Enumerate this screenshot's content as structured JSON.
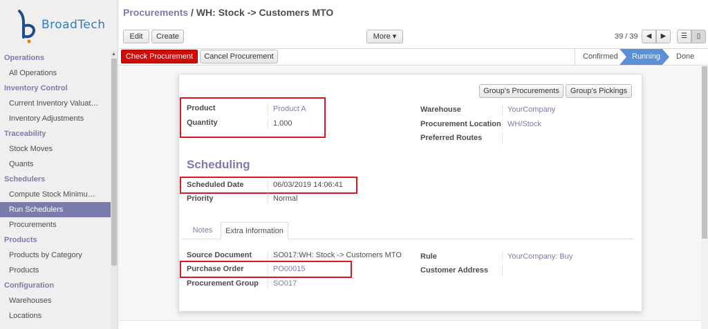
{
  "app": {
    "logo_text": "BroadTech"
  },
  "sidebar": {
    "sections": [
      {
        "title": "Operations",
        "items": [
          "All Operations"
        ]
      },
      {
        "title": "Inventory Control",
        "items": [
          "Current Inventory Valuat…",
          "Inventory Adjustments"
        ]
      },
      {
        "title": "Traceability",
        "items": [
          "Stock Moves",
          "Quants"
        ]
      },
      {
        "title": "Schedulers",
        "items": [
          "Compute Stock Minimu…",
          "Run Schedulers",
          "Procurements"
        ]
      },
      {
        "title": "Products",
        "items": [
          "Products by Category",
          "Products"
        ]
      },
      {
        "title": "Configuration",
        "items": [
          "Warehouses",
          "Locations"
        ]
      }
    ],
    "active_item": "Run Schedulers"
  },
  "breadcrumb": {
    "parent": "Procurements",
    "separator": " / ",
    "current": "WH: Stock -> Customers MTO"
  },
  "toolbar": {
    "edit_label": "Edit",
    "create_label": "Create",
    "more_label": "More ▾",
    "pager": "39 / 39"
  },
  "statusbar": {
    "check_label": "Check Procurement",
    "cancel_label": "Cancel Procurement",
    "stages": [
      "Confirmed",
      "Running",
      "Done"
    ],
    "active_stage": "Running",
    "active_color": "#5d8fd6"
  },
  "form": {
    "group_procurements_label": "Group's Procurements",
    "group_pickings_label": "Group's Pickings",
    "product_label": "Product",
    "product_value": "Product A",
    "quantity_label": "Quantity",
    "quantity_value": "1.000",
    "warehouse_label": "Warehouse",
    "warehouse_value": "YourCompany",
    "location_label": "Procurement Location",
    "location_value": "WH/Stock",
    "routes_label": "Preferred Routes",
    "scheduling_title": "Scheduling",
    "scheduled_date_label": "Scheduled Date",
    "scheduled_date_value": "06/03/2019 14:06:41",
    "priority_label": "Priority",
    "priority_value": "Normal",
    "tabs": [
      "Notes",
      "Extra Information"
    ],
    "active_tab": "Extra Information",
    "source_doc_label": "Source Document",
    "source_doc_value": "SO017:WH: Stock -> Customers MTO",
    "purchase_order_label": "Purchase Order",
    "purchase_order_value": "PO00015",
    "proc_group_label": "Procurement Group",
    "proc_group_value": "SO017",
    "rule_label": "Rule",
    "rule_value": "YourCompany: Buy",
    "customer_address_label": "Customer Address"
  },
  "colors": {
    "accent": "#7c7bad",
    "primary_button": "#d20a0a",
    "highlight_box": "#e0141a"
  }
}
